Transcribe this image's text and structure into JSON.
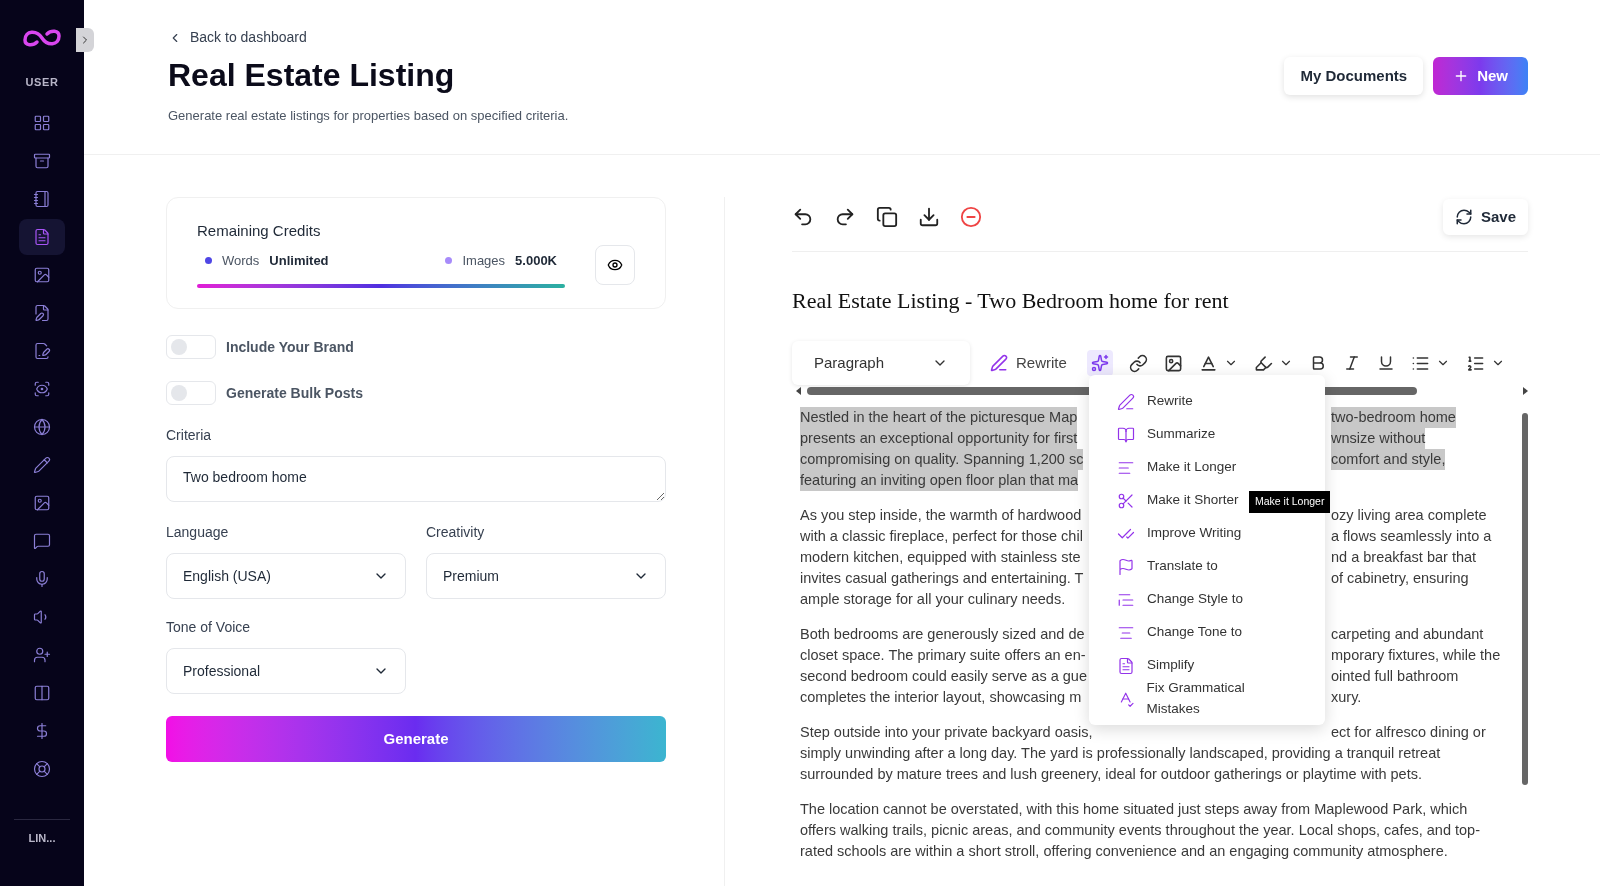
{
  "sidebar": {
    "section_label": "USER",
    "items": [
      {
        "selected": false
      },
      {
        "selected": false
      },
      {
        "selected": false
      },
      {
        "selected": true
      },
      {
        "selected": false
      },
      {
        "selected": false
      },
      {
        "selected": false
      },
      {
        "selected": false
      },
      {
        "selected": false
      },
      {
        "selected": false
      },
      {
        "selected": false
      },
      {
        "selected": false
      },
      {
        "selected": false
      },
      {
        "selected": false
      },
      {
        "selected": false
      },
      {
        "selected": false
      },
      {
        "selected": false
      },
      {
        "selected": false
      }
    ],
    "footer_label": "LIN..."
  },
  "header": {
    "back_link": "Back to dashboard",
    "title": "Real Estate Listing",
    "subtitle": "Generate real estate listings for properties based on specified criteria.",
    "buttons": [
      {
        "label": "My Documents",
        "kind": "secondary"
      },
      {
        "label": "New",
        "kind": "primary"
      }
    ]
  },
  "credits": {
    "title": "Remaining Credits",
    "items": [
      {
        "label": "Words",
        "value": "Unlimited",
        "color": "#4f46e5"
      },
      {
        "label": "Images",
        "value": "5.000K",
        "color": "#a78bfa"
      }
    ]
  },
  "toggles": [
    {
      "label": "Include Your Brand",
      "on": false
    },
    {
      "label": "Generate Bulk Posts",
      "on": false
    }
  ],
  "criteria": {
    "label": "Criteria",
    "value": "Two bedroom home"
  },
  "language": {
    "label": "Language",
    "value": "English (USA)"
  },
  "creativity": {
    "label": "Creativity",
    "value": "Premium"
  },
  "tone": {
    "label": "Tone of Voice",
    "value": "Professional"
  },
  "generate_button": "Generate",
  "editor": {
    "save_button": "Save",
    "document_title": "Real Estate Listing - Two Bedroom home for rent",
    "format_toolbar": {
      "block_style": "Paragraph",
      "rewrite": "Rewrite",
      "ai_selected": true
    },
    "ai_menu": [
      "Rewrite",
      "Summarize",
      "Make it Longer",
      "Make it Shorter",
      "Improve Writing",
      "Translate to",
      "Change Style to",
      "Change Tone to",
      "Simplify",
      "Fix Grammatical Mistakes"
    ],
    "tooltip": "Make it Longer",
    "paragraphs": [
      {
        "highlighted": true,
        "lines": [
          {
            "left": "Nestled in the heart of the picturesque Map",
            "right": "two-bedroom home"
          },
          {
            "left": "presents an exceptional opportunity for first",
            "right": "wnsize without"
          },
          {
            "left": "compromising on quality. Spanning 1,200 sc",
            "right": "comfort and style,"
          },
          {
            "left": "featuring an inviting open floor plan that ma"
          }
        ]
      },
      {
        "highlighted": false,
        "lines": [
          {
            "left": "As you step inside, the warmth of hardwood",
            "right": "ozy living area complete"
          },
          {
            "left": "with a classic fireplace, perfect for those chil",
            "right": "a flows seamlessly into a"
          },
          {
            "left": "modern kitchen, equipped with stainless ste",
            "right": "nd a breakfast bar that"
          },
          {
            "left": "invites casual gatherings and entertaining. T",
            "right": "of cabinetry, ensuring"
          },
          {
            "left": "ample storage for all your culinary needs."
          }
        ]
      },
      {
        "highlighted": false,
        "lines": [
          {
            "left": "Both bedrooms are generously sized and de",
            "right": "carpeting and abundant"
          },
          {
            "left": "closet space. The primary suite offers an en-",
            "right": "mporary fixtures, while the"
          },
          {
            "left": "second bedroom could easily serve as a gue",
            "right": "ointed full bathroom"
          },
          {
            "left": "completes the interior layout, showcasing m",
            "right": "xury."
          }
        ]
      },
      {
        "highlighted": false,
        "lines": [
          {
            "left": "Step outside into your private backyard oasis,",
            "right": "ect for alfresco dining or"
          },
          {
            "text": "simply unwinding after a long day. The yard is professionally landscaped, providing a tranquil retreat"
          },
          {
            "text": "surrounded by mature trees and lush greenery, ideal for outdoor gatherings or playtime with pets."
          }
        ]
      },
      {
        "highlighted": false,
        "lines": [
          {
            "text": "The location cannot be overstated, with this home situated just steps away from Maplewood Park, which"
          },
          {
            "text": "offers walking trails, picnic areas, and community events throughout the year. Local shops, cafes, and top-"
          },
          {
            "text": "rated schools are within a short stroll, offering convenience and an engaging community atmosphere."
          }
        ]
      }
    ]
  }
}
